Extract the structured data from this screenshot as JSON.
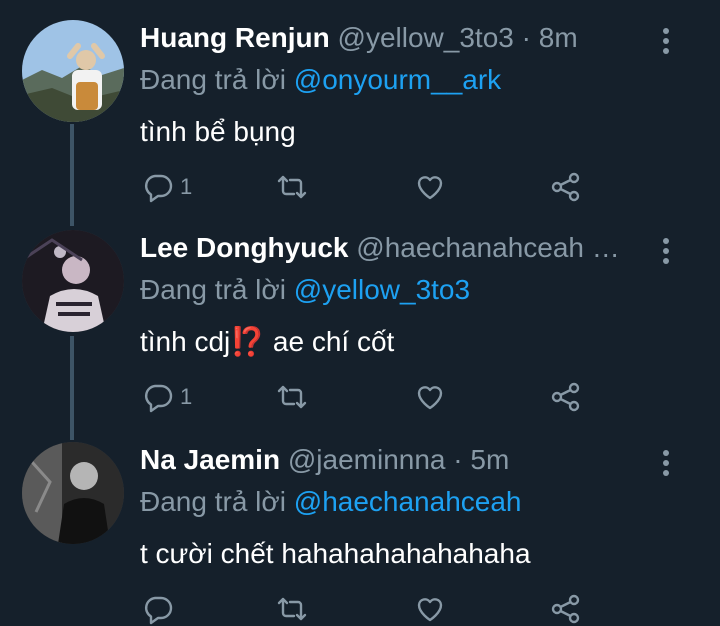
{
  "replying_prefix": "Đang trả lời",
  "tweets": [
    {
      "name": "Huang Renjun",
      "handle": "@yellow_3to3",
      "dot": "·",
      "time": "8m",
      "reply_to": "@onyourm__ark",
      "text": "tình bể bụng",
      "reply_count": "1",
      "avatar_icon": "avatar-mountain-photo"
    },
    {
      "name": "Lee Donghyuck",
      "handle": "@haechanahceah …",
      "dot": "",
      "time": "",
      "reply_to": "@yellow_3to3",
      "text": "tình cdj⁉️ ae chí cốt",
      "reply_count": "1",
      "avatar_icon": "avatar-night-photo"
    },
    {
      "name": "Na Jaemin",
      "handle": "@jaeminnna",
      "dot": "·",
      "time": "5m",
      "reply_to": "@haechanahceah",
      "text": "t cười chết hahahahahahahaha",
      "reply_count": "",
      "avatar_icon": "avatar-bw-photo"
    }
  ],
  "colors": {
    "background": "#15202b",
    "muted": "#8899a6",
    "link": "#1da1f2",
    "thread_line": "#3d5466"
  }
}
